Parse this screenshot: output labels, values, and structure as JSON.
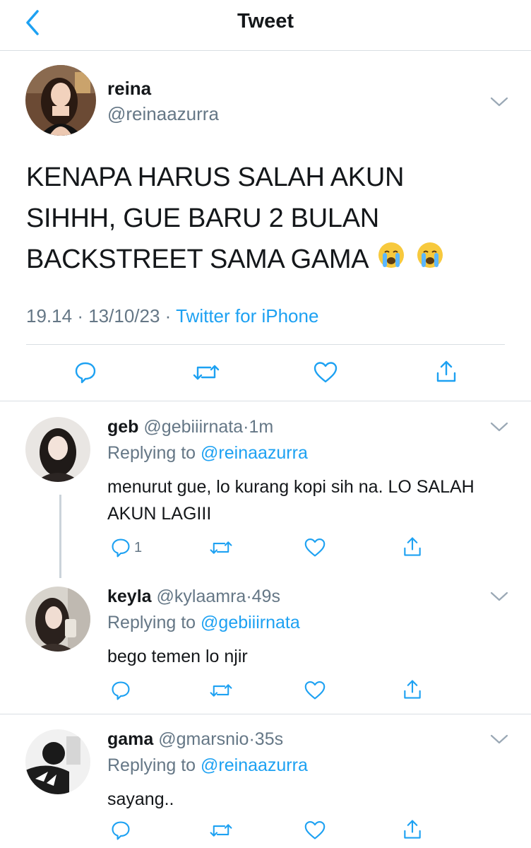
{
  "header": {
    "title": "Tweet",
    "back_icon": "chevron-left-icon"
  },
  "colors": {
    "accent": "#1da1f2",
    "muted": "#657786",
    "border": "#d9dee3"
  },
  "main_tweet": {
    "name": "reina",
    "handle": "@reinaazurra",
    "text": "KENAPA HARUS SALAH AKUN SIHHH, GUE BARU 2 BULAN BACKSTREET SAMA GAMA",
    "emojis": [
      "loudly-crying-face",
      "loudly-crying-face"
    ],
    "time": "19.14",
    "date": "13/10/23",
    "source": "Twitter for iPhone",
    "sep": "·"
  },
  "replies": [
    {
      "name": "geb",
      "handle": "@gebiiirnata",
      "time": "1m",
      "replying_label": "Replying to",
      "replying_to": "@reinaazurra",
      "text": "menurut gue, lo kurang kopi sih na. LO SALAH AKUN LAGIII",
      "reply_count": "1"
    },
    {
      "name": "keyla",
      "handle": "@kylaamra",
      "time": "49s",
      "replying_label": "Replying to",
      "replying_to": "@gebiiirnata",
      "text": "bego temen lo njir",
      "reply_count": ""
    },
    {
      "name": "gama",
      "handle": "@gmarsnio",
      "time": "35s",
      "replying_label": "Replying to",
      "replying_to": "@reinaazurra",
      "text": "sayang..",
      "reply_count": ""
    }
  ]
}
